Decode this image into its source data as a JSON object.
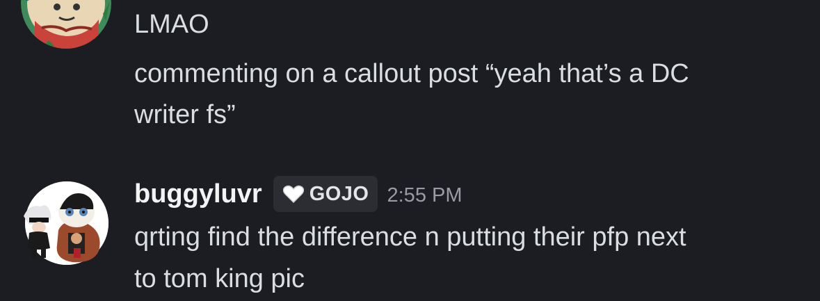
{
  "messages": [
    {
      "lines": [
        "LMAO",
        "commenting on a callout post “yeah that’s a DC",
        "writer fs”"
      ]
    },
    {
      "author": "buggyluvr",
      "role_tag": "GOJO",
      "role_icon": "heart-icon",
      "timestamp": "2:55 PM",
      "lines": [
        "qrting find the difference n putting their pfp next",
        "to tom king pic"
      ]
    }
  ]
}
